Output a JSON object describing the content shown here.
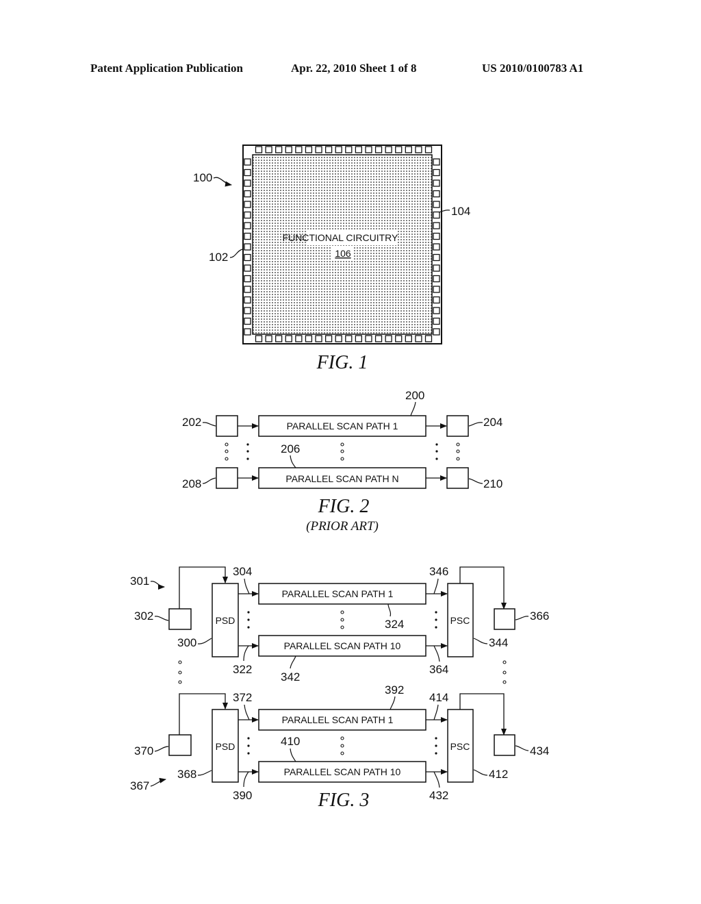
{
  "header": {
    "left": "Patent Application Publication",
    "center": "Apr. 22, 2010  Sheet 1 of 8",
    "right": "US 2010/0100783 A1"
  },
  "fig1": {
    "caption": "FIG.  1",
    "ref_chip": "100",
    "ref_left_pad": "102",
    "ref_right_pad": "104",
    "core_label": "FUNCTIONAL  CIRCUITRY",
    "core_ref": "106",
    "pads_per_side_top": 18,
    "pads_per_side_left": 17
  },
  "fig2": {
    "caption": "FIG.  2",
    "subcaption": "(PRIOR ART)",
    "path1": "PARALLEL  SCAN  PATH  1",
    "pathN": "PARALLEL  SCAN  PATH  N",
    "refs": {
      "r200": "200",
      "r202": "202",
      "r204": "204",
      "r206": "206",
      "r208": "208",
      "r210": "210"
    }
  },
  "fig3": {
    "caption": "FIG.  3",
    "psd": "PSD",
    "psc": "PSC",
    "path1": "PARALLEL  SCAN  PATH  1",
    "path10": "PARALLEL  SCAN  PATH  10",
    "top": {
      "r301": "301",
      "r302": "302",
      "r300": "300",
      "r304": "304",
      "r322": "322",
      "r324": "324",
      "r342": "342",
      "r346": "346",
      "r364": "364",
      "r344": "344",
      "r366": "366"
    },
    "bottom": {
      "r367": "367",
      "r370": "370",
      "r368": "368",
      "r372": "372",
      "r390": "390",
      "r392": "392",
      "r410": "410",
      "r414": "414",
      "r432": "432",
      "r412": "412",
      "r434": "434"
    }
  }
}
